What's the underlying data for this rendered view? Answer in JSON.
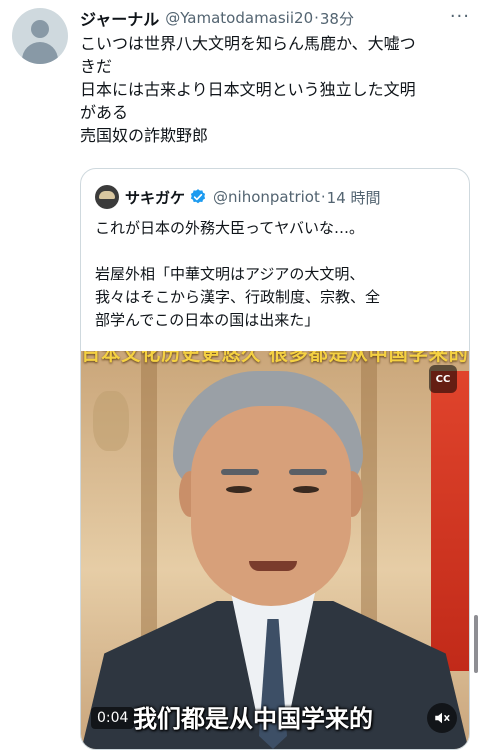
{
  "tweet": {
    "display_name": "ジャーナル",
    "handle": "@Yamatodamasii20",
    "separator": "·",
    "time": "38分",
    "more_icon": "···",
    "text_lines": [
      "こいつは世界八大文明を知らん馬鹿か、大嘘つ",
      "きだ",
      "日本には古来より日本文明という独立した文明",
      "がある",
      "売国奴の詐欺野郎"
    ]
  },
  "quote": {
    "display_name": "サキガケ",
    "handle": "@nihonpatriot",
    "separator": "·",
    "time": "14 時間",
    "verified_icon": "verified-badge-icon",
    "text_lines": [
      "これが日本の外務大臣ってヤバいな…。",
      "",
      "岩屋外相「中華文明はアジアの大文明、",
      "我々はそこから漢字、行政制度、宗教、全",
      "部学んでこの日本の国は出来た」"
    ],
    "media": {
      "top_subtitle": "日本文化历史更悠久 很多都是从中国学来的",
      "bottom_subtitle": "我们都是从中国学来的",
      "timestamp": "0:04",
      "cc_label": "CC"
    }
  },
  "colors": {
    "text": "#0f1419",
    "secondary": "#536471",
    "border": "#cfd9de",
    "verified": "#1d9bf0"
  }
}
